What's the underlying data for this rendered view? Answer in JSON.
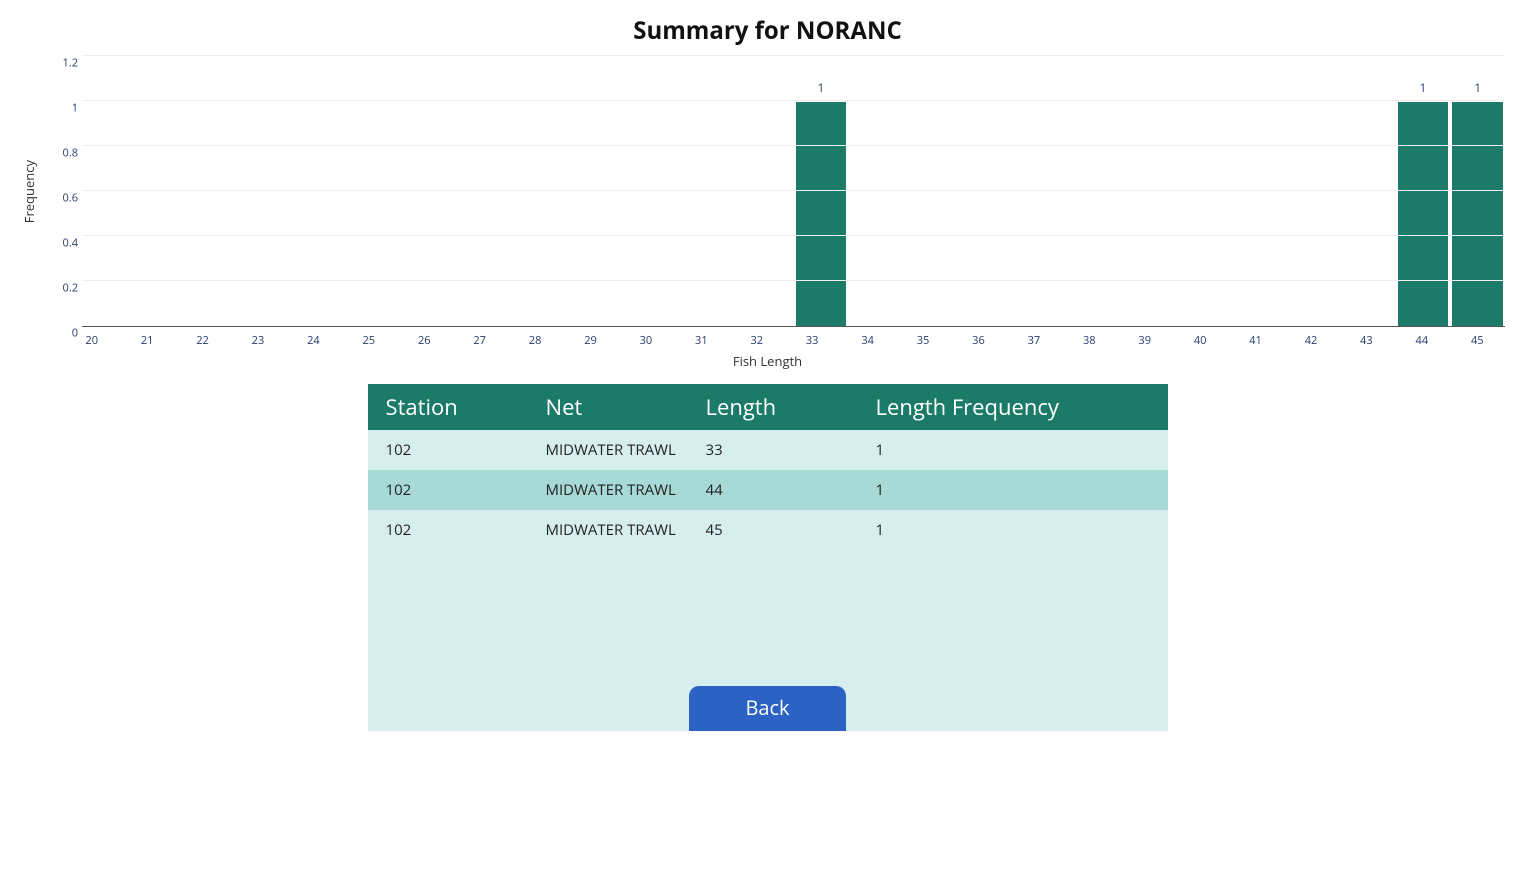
{
  "title": "Summary for NORANC",
  "back_label": "Back",
  "chart_data": {
    "type": "bar",
    "title": "Summary for NORANC",
    "xlabel": "Fish Length",
    "ylabel": "Frequency",
    "ylim": [
      0,
      1.2
    ],
    "yticks": [
      0,
      0.2,
      0.4,
      0.6,
      0.8,
      1,
      1.2
    ],
    "categories": [
      20,
      21,
      22,
      23,
      24,
      25,
      26,
      27,
      28,
      29,
      30,
      31,
      32,
      33,
      34,
      35,
      36,
      37,
      38,
      39,
      40,
      41,
      42,
      43,
      44,
      45
    ],
    "values": [
      0,
      0,
      0,
      0,
      0,
      0,
      0,
      0,
      0,
      0,
      0,
      0,
      0,
      1,
      0,
      0,
      0,
      0,
      0,
      0,
      0,
      0,
      0,
      0,
      1,
      1
    ],
    "bar_color": "#1b7b68"
  },
  "table": {
    "headers": {
      "station": "Station",
      "net": "Net",
      "length": "Length",
      "freq": "Length Frequency"
    },
    "rows": [
      {
        "station": "102",
        "net": "MIDWATER TRAWL",
        "length": "33",
        "freq": "1"
      },
      {
        "station": "102",
        "net": "MIDWATER TRAWL",
        "length": "44",
        "freq": "1"
      },
      {
        "station": "102",
        "net": "MIDWATER TRAWL",
        "length": "45",
        "freq": "1"
      }
    ]
  }
}
